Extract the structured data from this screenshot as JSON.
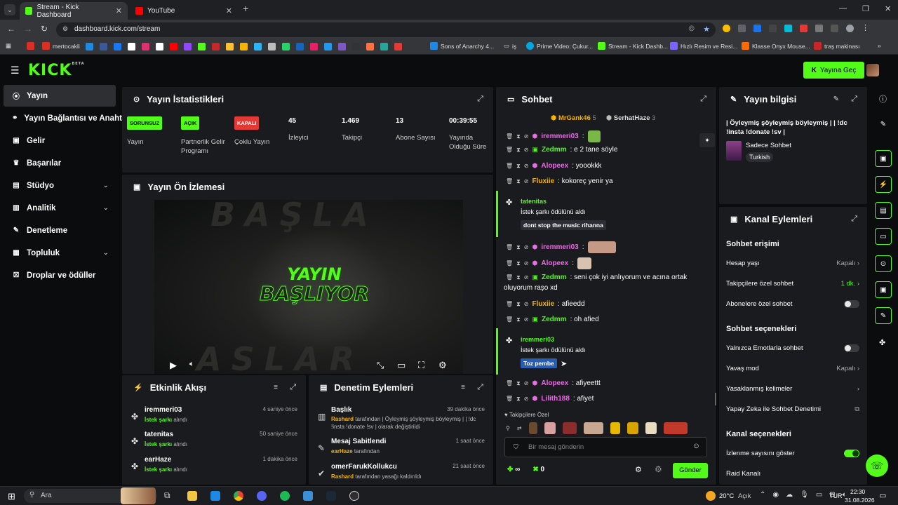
{
  "browser": {
    "tabs": [
      {
        "title": "Stream - Kick Dashboard",
        "active": true
      },
      {
        "title": "YouTube",
        "active": false
      }
    ],
    "url": "dashboard.kick.com/stream"
  },
  "bookmarks": [
    {
      "label": "mertocakli",
      "color": "#d93025"
    },
    {
      "label": "Sons of Anarchy 4...",
      "color": "#1e88e5"
    },
    {
      "label": "iş",
      "color": "#777"
    },
    {
      "label": "Prime Video: Çukur...",
      "color": "#00a8e1"
    },
    {
      "label": "Stream - Kick Dashb...",
      "color": "#53fc18"
    },
    {
      "label": "Hızlı Resim ve Resi...",
      "color": "#7b61ff"
    },
    {
      "label": "Klasse Onyx Mouse...",
      "color": "#ff6a00"
    },
    {
      "label": "traş makinası",
      "color": "#c62828"
    }
  ],
  "header": {
    "logo": "KICK",
    "logo_beta": "BETA",
    "go_live": "Yayına Geç"
  },
  "sidebar": {
    "items": [
      {
        "label": "Yayın",
        "icon": "broadcast-icon",
        "selected": true
      },
      {
        "label": "Yayın Bağlantısı ve Anahtarı",
        "icon": "link-icon"
      },
      {
        "label": "Gelir",
        "icon": "wallet-icon"
      },
      {
        "label": "Başarılar",
        "icon": "trophy-icon"
      },
      {
        "label": "Stüdyo",
        "icon": "studio-icon",
        "expandable": true
      },
      {
        "label": "Analitik",
        "icon": "chart-icon",
        "expandable": true
      },
      {
        "label": "Denetleme",
        "icon": "wrench-icon"
      },
      {
        "label": "Topluluk",
        "icon": "community-icon",
        "expandable": true
      },
      {
        "label": "Droplar ve ödüller",
        "icon": "gift-icon"
      }
    ]
  },
  "stats": {
    "title": "Yayın İstatistikleri",
    "cols": [
      {
        "badge": "SORUNSUZ",
        "badge_color": "#53fc18",
        "label": "Yayın"
      },
      {
        "badge": "AÇIK",
        "badge_color": "#53fc18",
        "label": "Partnerlik Gelir Programı"
      },
      {
        "badge": "KAPALI",
        "badge_color": "#e53935",
        "label": "Çoklu Yayın"
      },
      {
        "value": "45",
        "label": "İzleyici"
      },
      {
        "value": "1.469",
        "label": "Takipçi"
      },
      {
        "value": "13",
        "label": "Abone Sayısı"
      },
      {
        "value": "00:39:55",
        "label": "Yayında Olduğu Süre"
      }
    ]
  },
  "preview": {
    "title": "Yayın Ön İzlemesi",
    "overlay_line1": "YAYIN",
    "overlay_line2": "BAŞLIYOR",
    "bg_top": "BAŞLA",
    "bg_bottom": "ASLAR"
  },
  "activity": {
    "title": "Etkinlik Akışı",
    "items": [
      {
        "user": "iremmeri03",
        "action": "İstek şarkı",
        "suffix": "alındı",
        "time": "4 saniye önce"
      },
      {
        "user": "tatenitas",
        "action": "İstek şarkı",
        "suffix": "alındı",
        "time": "50 saniye önce"
      },
      {
        "user": "earHaze",
        "action": "İstek şarkı",
        "suffix": "alındı",
        "time": "1 dakika önce"
      }
    ]
  },
  "moderation": {
    "title": "Denetim Eylemleri",
    "items": [
      {
        "title": "Başlık",
        "user": "Rashard",
        "text": "tarafından | Öyleymiş şöyleymiş böyleymiş | | !dc !insta !donate !sv | olarak değiştirildi",
        "time": "39 dakika önce"
      },
      {
        "title": "Mesaj Sabitlendi",
        "user": "earHaze",
        "text": "tarafından",
        "time": "1 saat önce"
      },
      {
        "title": "omerFarukKollukcu",
        "user": "Rashard",
        "text": "tarafından yasağı kaldırıldı",
        "time": "21 saat önce"
      }
    ]
  },
  "chat": {
    "title": "Sohbet",
    "top_gifters": [
      {
        "name": "MrGank46",
        "count": "5"
      },
      {
        "name": "SerhatHaze",
        "count": "3"
      }
    ],
    "messages": [
      {
        "user": "iremmeri03",
        "color": "#e86ee3",
        "text": ":",
        "emote": "#7ab648"
      },
      {
        "user": "Zedmm",
        "color": "#53fc18",
        "text": ": e 2 tane söyle"
      },
      {
        "user": "Alopeex",
        "color": "#e86ee3",
        "text": ": yoookkk"
      },
      {
        "user": "Fluxiie",
        "color": "#f4b400",
        "text": ": kokoreç yenir ya"
      },
      {
        "user": "iremmeri03",
        "color": "#e86ee3",
        "text": ":",
        "emote": "#c49a86"
      },
      {
        "user": "Alopeex",
        "color": "#e86ee3",
        "text": ":",
        "emote": "#d8c2b0"
      },
      {
        "user": "Zedmm",
        "color": "#53fc18",
        "text": ": seni çok iyi anlıyorum ve acına ortak",
        "text2": "oluyorum raşo xd"
      },
      {
        "user": "Fluxiie",
        "color": "#f4b400",
        "text": ": afieedd"
      },
      {
        "user": "Zedmm",
        "color": "#53fc18",
        "text": ": oh afied"
      },
      {
        "user": "Alopeex",
        "color": "#e86ee3",
        "text": ": afiyeettt"
      },
      {
        "user": "Lilith188",
        "color": "#e86ee3",
        "text": ": afiyet"
      }
    ],
    "redemptions": [
      {
        "user": "tatenitas",
        "action": "İstek şarkı ödülünü aldı",
        "pill": "dont stop the music rihanna"
      },
      {
        "user": "iremmeri03",
        "action": "İstek şarkı ödülünü aldı",
        "pill": "Toz pembe"
      }
    ],
    "followers_only": "Takipçilere Özel",
    "placeholder": "Bir mesaj gönderin",
    "send": "Gönder",
    "points": "0",
    "infinity": "∞"
  },
  "stream_info": {
    "title": "Yayın bilgisi",
    "stream_title": "| Öyleymiş şöyleymiş böyleymiş | | !dc !insta !donate !sv |",
    "category": "Sadece Sohbet",
    "tag": "Turkish"
  },
  "channel": {
    "title": "Kanal Eylemleri",
    "access_title": "Sohbet erişimi",
    "account_age": "Hesap yaşı",
    "account_age_val": "Kapalı",
    "followers_chat": "Takipçilere özel sohbet",
    "followers_chat_val": "1 dk.",
    "subs_chat": "Abonelere özel sohbet",
    "options_title": "Sohbet seçenekleri",
    "emote_only": "Yalnızca Emotlarla sohbet",
    "slow": "Yavaş mod",
    "slow_val": "Kapalı",
    "banned_words": "Yasaklanmış kelimeler",
    "ai_mod": "Yapay Zeka ile Sohbet Denetimi",
    "chan_opts": "Kanal seçenekleri",
    "show_views": "İzlenme sayısını göster",
    "raid": "Raid Kanalı"
  },
  "taskbar": {
    "search": "Ara",
    "weather": "20°C",
    "weather_desc": "Açık",
    "lang": "TUR",
    "time": "22:30",
    "date": "31.08.2026"
  }
}
